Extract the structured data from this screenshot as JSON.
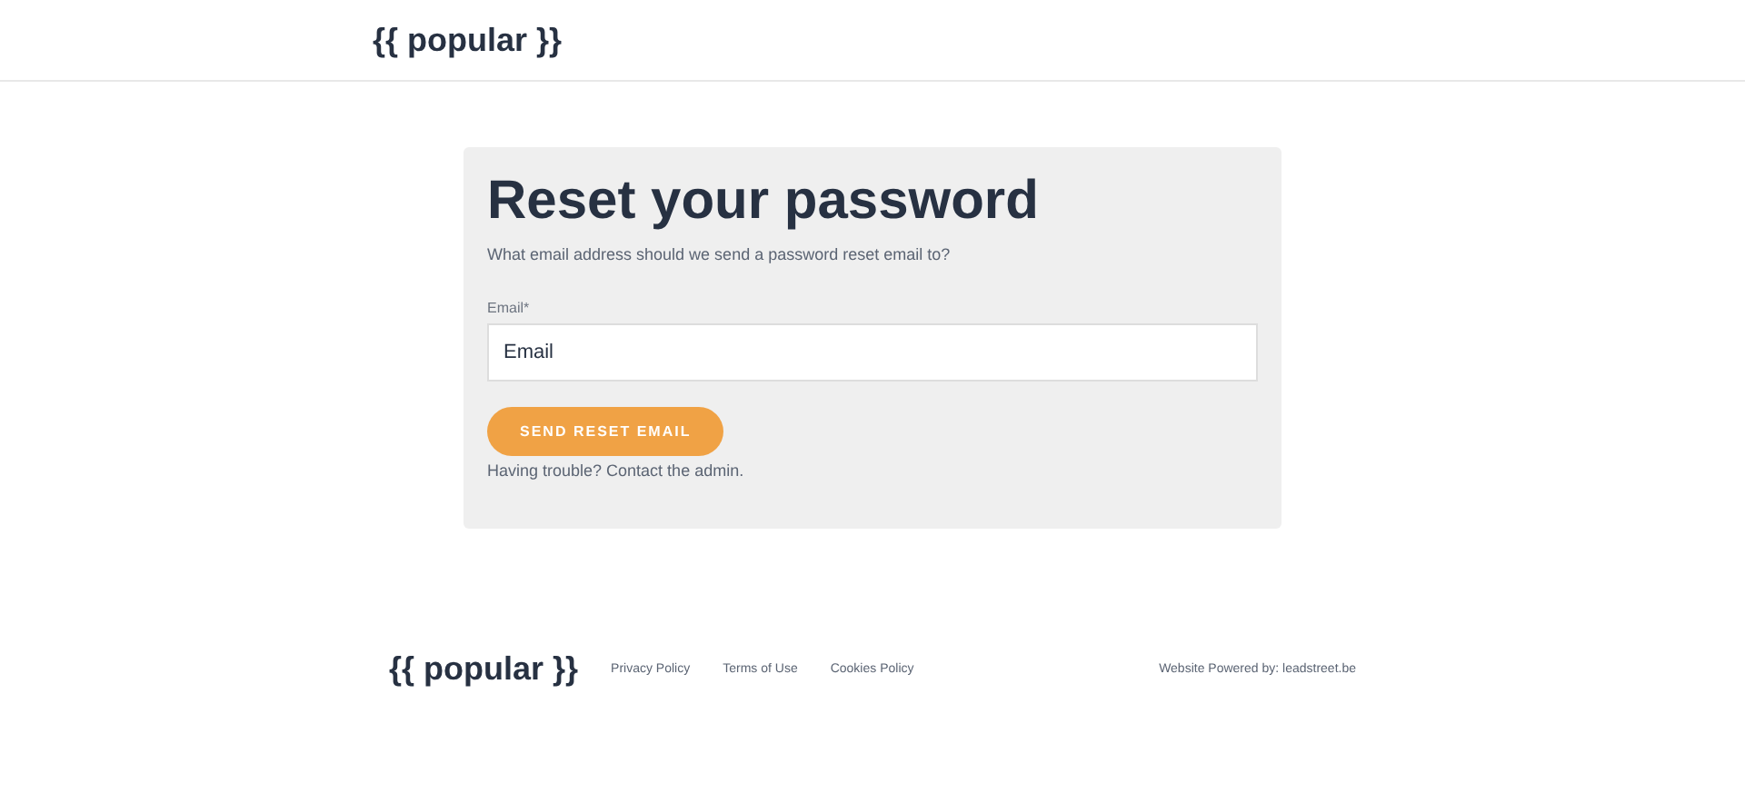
{
  "header": {
    "logo": "{{ popular }}"
  },
  "form": {
    "title": "Reset your password",
    "subtitle": "What email address should we send a password reset email to?",
    "email_field": {
      "label": "Email*",
      "placeholder": "Email"
    },
    "submit_button": "SEND RESET EMAIL",
    "help_text": "Having trouble? Contact the admin."
  },
  "footer": {
    "logo": "{{ popular }}",
    "links": [
      "Privacy Policy",
      "Terms of Use",
      "Cookies Policy"
    ],
    "powered_by": "Website Powered by: leadstreet.be"
  }
}
